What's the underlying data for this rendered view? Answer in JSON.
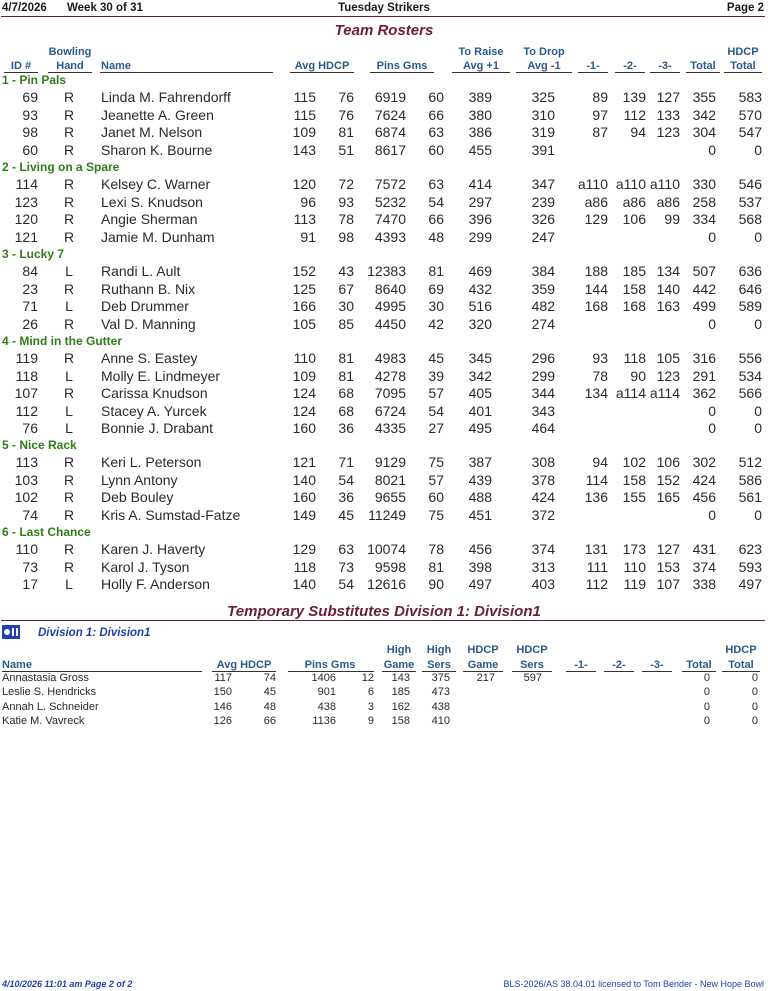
{
  "header": {
    "date": "4/7/2026",
    "week": "Week 30 of 31",
    "league": "Tuesday Strikers",
    "page": "Page 2"
  },
  "rosters": {
    "title": "Team Rosters",
    "columns": {
      "id": "ID #",
      "hand1": "Bowling",
      "hand2": "Hand",
      "name": "Name",
      "avg_hdcp": "Avg HDCP",
      "pins_gms": "Pins Gms",
      "raise1": "To Raise",
      "raise2": "Avg +1",
      "drop1": "To Drop",
      "drop2": "Avg -1",
      "g1": "-1-",
      "g2": "-2-",
      "g3": "-3-",
      "total": "Total",
      "hdcp_total1": "HDCP",
      "hdcp_total2": "Total"
    },
    "teams": [
      {
        "name": "1 - Pin Pals",
        "rows": [
          [
            "69",
            "R",
            "Linda M. Fahrendorff",
            "115",
            "76",
            "6919",
            "60",
            "389",
            "325",
            "89",
            "139",
            "127",
            "355",
            "583"
          ],
          [
            "93",
            "R",
            "Jeanette A. Green",
            "115",
            "76",
            "7624",
            "66",
            "380",
            "310",
            "97",
            "112",
            "133",
            "342",
            "570"
          ],
          [
            "98",
            "R",
            "Janet M. Nelson",
            "109",
            "81",
            "6874",
            "63",
            "386",
            "319",
            "87",
            "94",
            "123",
            "304",
            "547"
          ],
          [
            "60",
            "R",
            "Sharon K. Bourne",
            "143",
            "51",
            "8617",
            "60",
            "455",
            "391",
            "",
            "",
            "",
            "0",
            "0"
          ]
        ]
      },
      {
        "name": "2 - Living on a Spare",
        "rows": [
          [
            "114",
            "R",
            "Kelsey C. Warner",
            "120",
            "72",
            "7572",
            "63",
            "414",
            "347",
            "a110",
            "a110",
            "a110",
            "330",
            "546"
          ],
          [
            "123",
            "R",
            "Lexi S. Knudson",
            "96",
            "93",
            "5232",
            "54",
            "297",
            "239",
            "a86",
            "a86",
            "a86",
            "258",
            "537"
          ],
          [
            "120",
            "R",
            "Angie Sherman",
            "113",
            "78",
            "7470",
            "66",
            "396",
            "326",
            "129",
            "106",
            "99",
            "334",
            "568"
          ],
          [
            "121",
            "R",
            "Jamie M. Dunham",
            "91",
            "98",
            "4393",
            "48",
            "299",
            "247",
            "",
            "",
            "",
            "0",
            "0"
          ]
        ]
      },
      {
        "name": "3 - Lucky 7",
        "rows": [
          [
            "84",
            "L",
            "Randi L. Ault",
            "152",
            "43",
            "12383",
            "81",
            "469",
            "384",
            "188",
            "185",
            "134",
            "507",
            "636"
          ],
          [
            "23",
            "R",
            "Ruthann B. Nix",
            "125",
            "67",
            "8640",
            "69",
            "432",
            "359",
            "144",
            "158",
            "140",
            "442",
            "646"
          ],
          [
            "71",
            "L",
            "Deb Drummer",
            "166",
            "30",
            "4995",
            "30",
            "516",
            "482",
            "168",
            "168",
            "163",
            "499",
            "589"
          ],
          [
            "26",
            "R",
            "Val D. Manning",
            "105",
            "85",
            "4450",
            "42",
            "320",
            "274",
            "",
            "",
            "",
            "0",
            "0"
          ]
        ]
      },
      {
        "name": "4 - Mind in the Gutter",
        "rows": [
          [
            "119",
            "R",
            "Anne S. Eastey",
            "110",
            "81",
            "4983",
            "45",
            "345",
            "296",
            "93",
            "118",
            "105",
            "316",
            "556"
          ],
          [
            "118",
            "L",
            "Molly E. Lindmeyer",
            "109",
            "81",
            "4278",
            "39",
            "342",
            "299",
            "78",
            "90",
            "123",
            "291",
            "534"
          ],
          [
            "107",
            "R",
            "Carissa Knudson",
            "124",
            "68",
            "7095",
            "57",
            "405",
            "344",
            "134",
            "a114",
            "a114",
            "362",
            "566"
          ],
          [
            "112",
            "L",
            "Stacey A. Yurcek",
            "124",
            "68",
            "6724",
            "54",
            "401",
            "343",
            "",
            "",
            "",
            "0",
            "0"
          ],
          [
            "76",
            "L",
            "Bonnie J. Drabant",
            "160",
            "36",
            "4335",
            "27",
            "495",
            "464",
            "",
            "",
            "",
            "0",
            "0"
          ]
        ]
      },
      {
        "name": "5 - Nice Rack",
        "rows": [
          [
            "113",
            "R",
            "Keri L. Peterson",
            "121",
            "71",
            "9129",
            "75",
            "387",
            "308",
            "94",
            "102",
            "106",
            "302",
            "512"
          ],
          [
            "103",
            "R",
            "Lynn Antony",
            "140",
            "54",
            "8021",
            "57",
            "439",
            "378",
            "114",
            "158",
            "152",
            "424",
            "586"
          ],
          [
            "102",
            "R",
            "Deb Bouley",
            "160",
            "36",
            "9655",
            "60",
            "488",
            "424",
            "136",
            "155",
            "165",
            "456",
            "561"
          ],
          [
            "74",
            "R",
            "Kris A. Sumstad-Fatze",
            "149",
            "45",
            "11249",
            "75",
            "451",
            "372",
            "",
            "",
            "",
            "0",
            "0"
          ]
        ]
      },
      {
        "name": "6 - Last Chance",
        "rows": [
          [
            "110",
            "R",
            "Karen J. Haverty",
            "129",
            "63",
            "10074",
            "78",
            "456",
            "374",
            "131",
            "173",
            "127",
            "431",
            "623"
          ],
          [
            "73",
            "R",
            "Karol J. Tyson",
            "118",
            "73",
            "9598",
            "81",
            "398",
            "313",
            "111",
            "110",
            "153",
            "374",
            "593"
          ],
          [
            "17",
            "L",
            "Holly F. Anderson",
            "140",
            "54",
            "12616",
            "90",
            "497",
            "403",
            "112",
            "119",
            "107",
            "338",
            "497"
          ]
        ]
      }
    ]
  },
  "subs": {
    "title": "Temporary Substitutes   Division 1: Division1",
    "division": "Division 1: Division1",
    "columns": {
      "name": "Name",
      "avg_hdcp": "Avg HDCP",
      "pins_gms": "Pins Gms",
      "high1": "High",
      "game": "Game",
      "high2": "High",
      "sers": "Sers",
      "hdcp1": "HDCP",
      "hdcp_game": "Game",
      "hdcp2": "HDCP",
      "hdcp_sers": "Sers",
      "g1": "-1-",
      "g2": "-2-",
      "g3": "-3-",
      "total": "Total",
      "hdcp_total1": "HDCP",
      "hdcp_total2": "Total"
    },
    "rows": [
      [
        "Annastasia Gross",
        "117",
        "74",
        "1406",
        "12",
        "143",
        "375",
        "217",
        "597",
        "0",
        "0"
      ],
      [
        "Leslie S. Hendricks",
        "150",
        "45",
        "901",
        "6",
        "185",
        "473",
        "",
        "",
        "0",
        "0"
      ],
      [
        "Annah L. Schneider",
        "146",
        "48",
        "438",
        "3",
        "162",
        "438",
        "",
        "",
        "0",
        "0"
      ],
      [
        "Katie M. Vavreck",
        "126",
        "66",
        "1136",
        "9",
        "158",
        "410",
        "",
        "",
        "0",
        "0"
      ]
    ]
  },
  "footer": {
    "left": "4/10/2026  11:01 am  Page 2 of 2",
    "right": "BLS-2026/AS 38.04.01 licensed to Tom Bender - New Hope Bowl"
  },
  "colors": {
    "title": "#6b2038",
    "header": "#2a5a8a",
    "team": "#2e7d1a",
    "sub": "#1e3fb0"
  }
}
